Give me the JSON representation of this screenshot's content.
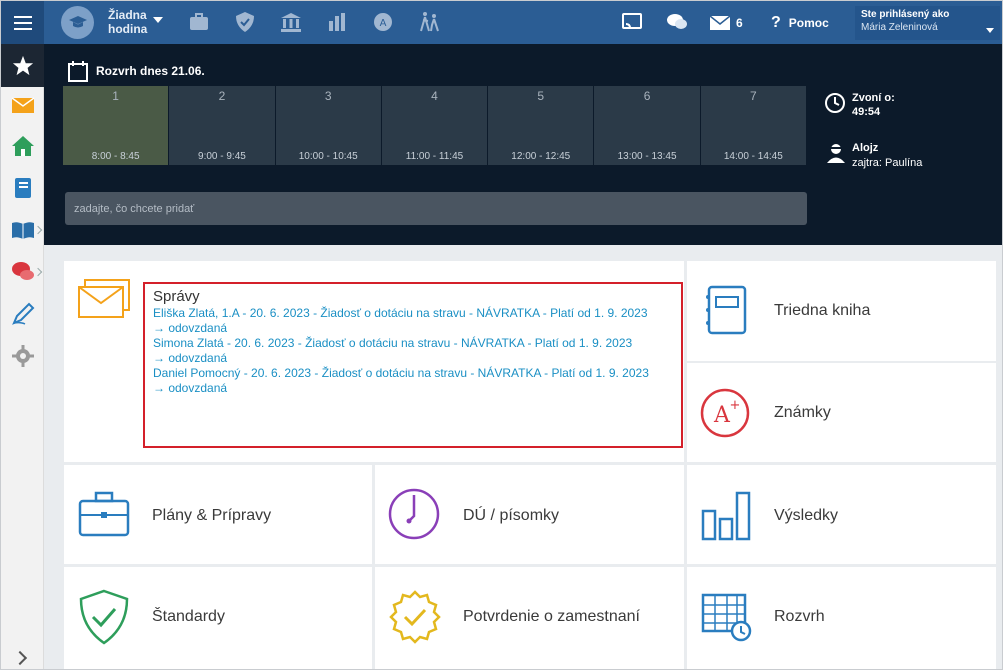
{
  "topbar": {
    "lesson_line1": "Žiadna",
    "lesson_line2": "hodina",
    "messages_count": "6",
    "help_label": "Pomoc",
    "user_label": "Ste prihlásený ako",
    "user_name": "Mária Zeleninová"
  },
  "schedule": {
    "title": "Rozvrh dnes 21.06.",
    "periods": [
      {
        "num": "1",
        "time": "8:00 - 8:45"
      },
      {
        "num": "2",
        "time": "9:00 - 9:45"
      },
      {
        "num": "3",
        "time": "10:00 - 10:45"
      },
      {
        "num": "4",
        "time": "11:00 - 11:45"
      },
      {
        "num": "5",
        "time": "12:00 - 12:45"
      },
      {
        "num": "6",
        "time": "13:00 - 13:45"
      },
      {
        "num": "7",
        "time": "14:00 - 14:45"
      }
    ],
    "add_placeholder": "zadajte, čo chcete pridať",
    "bell_label": "Zvoní o:",
    "bell_time": "49:54",
    "duty_name": "Alojz",
    "duty_tomorrow": "zajtra: Paulína"
  },
  "spravy": {
    "title": "Správy",
    "messages": [
      {
        "text": "Eliška Zlatá, 1.A - 20. 6. 2023 - Žiadosť o dotáciu na stravu - NÁVRATKA - Platí od 1. 9. 2023",
        "status": "→ odovzdaná"
      },
      {
        "text": "Simona Zlatá - 20. 6. 2023 - Žiadosť o dotáciu na stravu - NÁVRATKA - Platí od 1. 9. 2023",
        "status": "→ odovzdaná"
      },
      {
        "text": "Daniel Pomocný - 20. 6. 2023 - Žiadosť o dotáciu na stravu - NÁVRATKA - Platí od 1. 9. 2023",
        "status": "→ odovzdaná"
      }
    ]
  },
  "tiles": {
    "triedna_kniha": "Triedna kniha",
    "znamky": "Známky",
    "plany": "Plány & Prípravy",
    "du": "DÚ / písomky",
    "vysledky": "Výsledky",
    "standardy": "Štandardy",
    "potvrdenie": "Potvrdenie o zamestnaní",
    "rozvrh": "Rozvrh"
  },
  "colors": {
    "topbar": "#2b5d94",
    "dark_panel": "#0c1a2a",
    "link": "#1a8fc4",
    "highlight_border": "#d4202a",
    "icon_blue": "#2a7dbf"
  }
}
